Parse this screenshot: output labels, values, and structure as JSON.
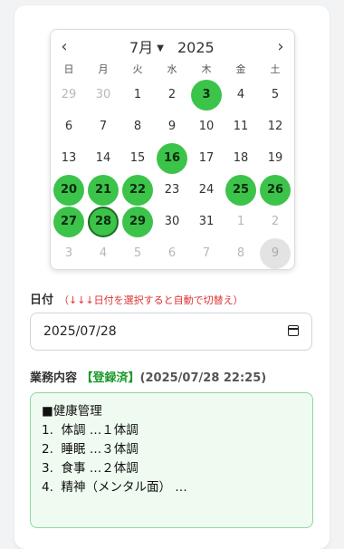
{
  "calendar": {
    "month_label": "7月",
    "year_label": "2025",
    "prev_label": "‹",
    "next_label": "›",
    "weekdays": [
      "日",
      "月",
      "火",
      "水",
      "木",
      "金",
      "土"
    ],
    "weeks": [
      [
        {
          "d": "29",
          "s": "other"
        },
        {
          "d": "30",
          "s": "other"
        },
        {
          "d": "1",
          "s": ""
        },
        {
          "d": "2",
          "s": ""
        },
        {
          "d": "3",
          "s": "reg"
        },
        {
          "d": "4",
          "s": ""
        },
        {
          "d": "5",
          "s": ""
        }
      ],
      [
        {
          "d": "6",
          "s": ""
        },
        {
          "d": "7",
          "s": ""
        },
        {
          "d": "8",
          "s": ""
        },
        {
          "d": "9",
          "s": ""
        },
        {
          "d": "10",
          "s": ""
        },
        {
          "d": "11",
          "s": ""
        },
        {
          "d": "12",
          "s": ""
        }
      ],
      [
        {
          "d": "13",
          "s": ""
        },
        {
          "d": "14",
          "s": ""
        },
        {
          "d": "15",
          "s": ""
        },
        {
          "d": "16",
          "s": "reg"
        },
        {
          "d": "17",
          "s": ""
        },
        {
          "d": "18",
          "s": ""
        },
        {
          "d": "19",
          "s": ""
        }
      ],
      [
        {
          "d": "20",
          "s": "reg"
        },
        {
          "d": "21",
          "s": "reg"
        },
        {
          "d": "22",
          "s": "reg"
        },
        {
          "d": "23",
          "s": ""
        },
        {
          "d": "24",
          "s": ""
        },
        {
          "d": "25",
          "s": "reg"
        },
        {
          "d": "26",
          "s": "reg"
        }
      ],
      [
        {
          "d": "27",
          "s": "reg"
        },
        {
          "d": "28",
          "s": "sel"
        },
        {
          "d": "29",
          "s": "reg"
        },
        {
          "d": "30",
          "s": ""
        },
        {
          "d": "31",
          "s": ""
        },
        {
          "d": "1",
          "s": "other"
        },
        {
          "d": "2",
          "s": "other"
        }
      ],
      [
        {
          "d": "3",
          "s": "other"
        },
        {
          "d": "4",
          "s": "other"
        },
        {
          "d": "5",
          "s": "other"
        },
        {
          "d": "6",
          "s": "other"
        },
        {
          "d": "7",
          "s": "other"
        },
        {
          "d": "8",
          "s": "other"
        },
        {
          "d": "9",
          "s": "today"
        }
      ]
    ]
  },
  "date_field": {
    "label": "日付",
    "hint": "（↓↓↓日付を選択すると自動で切替え）",
    "value": "2025/07/28"
  },
  "work": {
    "label": "業務内容",
    "status": "【登録済】",
    "timestamp": "(2025/07/28 22:25)",
    "lines": [
      "■健康管理",
      "1.  体調 …１体調",
      "2.  睡眠 …３体調",
      "3.  食事 …２体調",
      "4.  精神（メンタル面） …"
    ]
  },
  "colors": {
    "registered": "#3cc34a",
    "selected_border": "#1e6b25",
    "hint": "#dd3333",
    "status": "#1a9a2a",
    "textarea_bg": "#effaf1"
  }
}
